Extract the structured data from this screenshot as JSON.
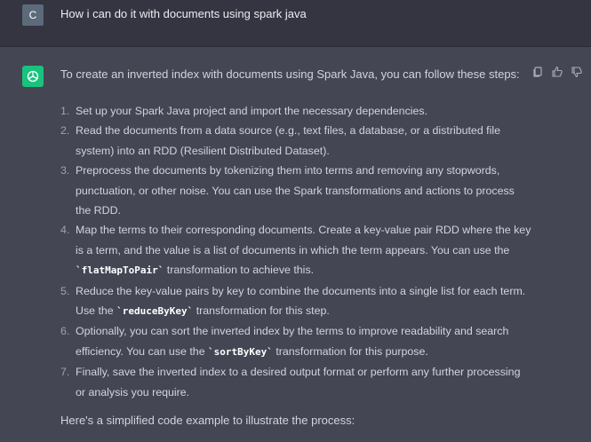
{
  "user": {
    "avatar_letter": "C",
    "message": "How i can do it with documents using spark java"
  },
  "assistant": {
    "intro": "To create an inverted index with documents using Spark Java, you can follow these steps:",
    "steps": [
      {
        "num": "1.",
        "pre": "Set up your Spark Java project and import the necessary dependencies.",
        "code": "",
        "post": ""
      },
      {
        "num": "2.",
        "pre": "Read the documents from a data source (e.g., text files, a database, or a distributed file system) into an RDD (Resilient Distributed Dataset).",
        "code": "",
        "post": ""
      },
      {
        "num": "3.",
        "pre": "Preprocess the documents by tokenizing them into terms and removing any stopwords, punctuation, or other noise. You can use the Spark transformations and actions to process the RDD.",
        "code": "",
        "post": ""
      },
      {
        "num": "4.",
        "pre": "Map the terms to their corresponding documents. Create a key-value pair RDD where the key is a term, and the value is a list of documents in which the term appears. You can use the ",
        "code": "`flatMapToPair`",
        "post": " transformation to achieve this."
      },
      {
        "num": "5.",
        "pre": "Reduce the key-value pairs by key to combine the documents into a single list for each term. Use the ",
        "code": "`reduceByKey`",
        "post": " transformation for this step."
      },
      {
        "num": "6.",
        "pre": "Optionally, you can sort the inverted index by the terms to improve readability and search efficiency. You can use the ",
        "code": "`sortByKey`",
        "post": " transformation for this purpose."
      },
      {
        "num": "7.",
        "pre": "Finally, save the inverted index to a desired output format or perform any further processing or analysis you require.",
        "code": "",
        "post": ""
      }
    ],
    "outro": "Here's a simplified code example to illustrate the process:"
  },
  "icons": [
    "copy-icon",
    "thumbs-up-icon",
    "thumbs-down-icon"
  ],
  "colors": {
    "page_bg": "#444654",
    "user_bg": "#343541",
    "accent": "#19c37d",
    "user_avatar": "#5c6a7a"
  }
}
